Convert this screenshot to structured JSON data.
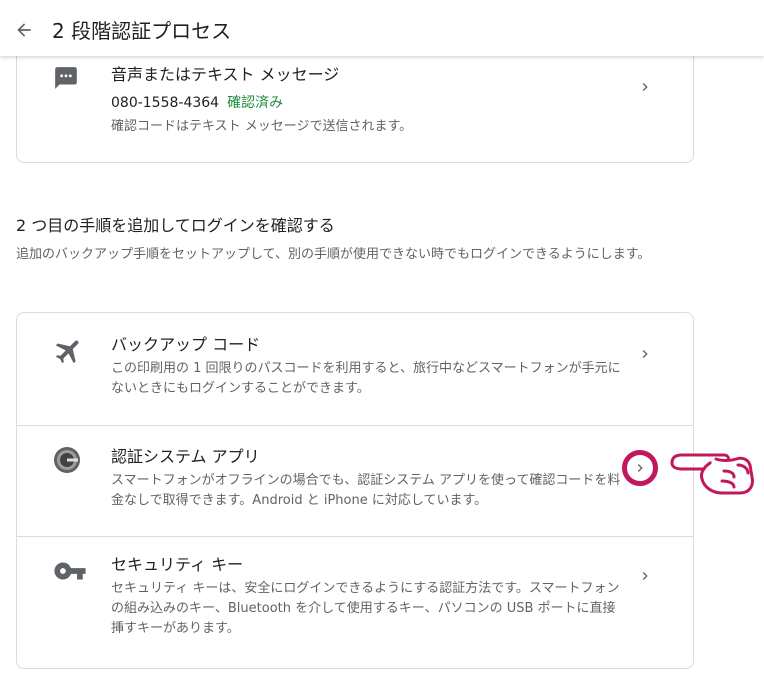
{
  "header": {
    "title": "2 段階認証プロセス",
    "back_icon": "arrow-back-icon"
  },
  "current_method": {
    "title": "音声またはテキスト メッセージ",
    "phone": "080-1558-4364",
    "status": "確認済み",
    "description": "確認コードはテキスト メッセージで送信されます。",
    "icon": "sms-icon"
  },
  "second_step": {
    "title": "2 つ目の手順を追加してログインを確認する",
    "description": "追加のバックアップ手順をセットアップして、別の手順が使用できない時でもログインできるようにします。",
    "options": [
      {
        "title": "バックアップ コード",
        "description": "この印刷用の 1 回限りのパスコードを利用すると、旅行中などスマートフォンが手元にないときにもログインすることができます。",
        "icon": "airplane-icon"
      },
      {
        "title": "認証システム アプリ",
        "description": "スマートフォンがオフラインの場合でも、認証システム アプリを使って確認コードを料金なしで取得できます。Android と iPhone に対応しています。",
        "icon": "google-authenticator-icon"
      },
      {
        "title": "セキュリティ キー",
        "description": "セキュリティ キーは、安全にログインできるようにする認証方法です。スマートフォンの組み込みのキー、Bluetooth を介して使用するキー、パソコンの USB ポートに直接挿すキーがあります。",
        "icon": "key-icon"
      }
    ]
  },
  "colors": {
    "verified": "#1e8e3e",
    "highlight": "#c2185b",
    "text": "#202124",
    "secondary": "#5f6368"
  }
}
